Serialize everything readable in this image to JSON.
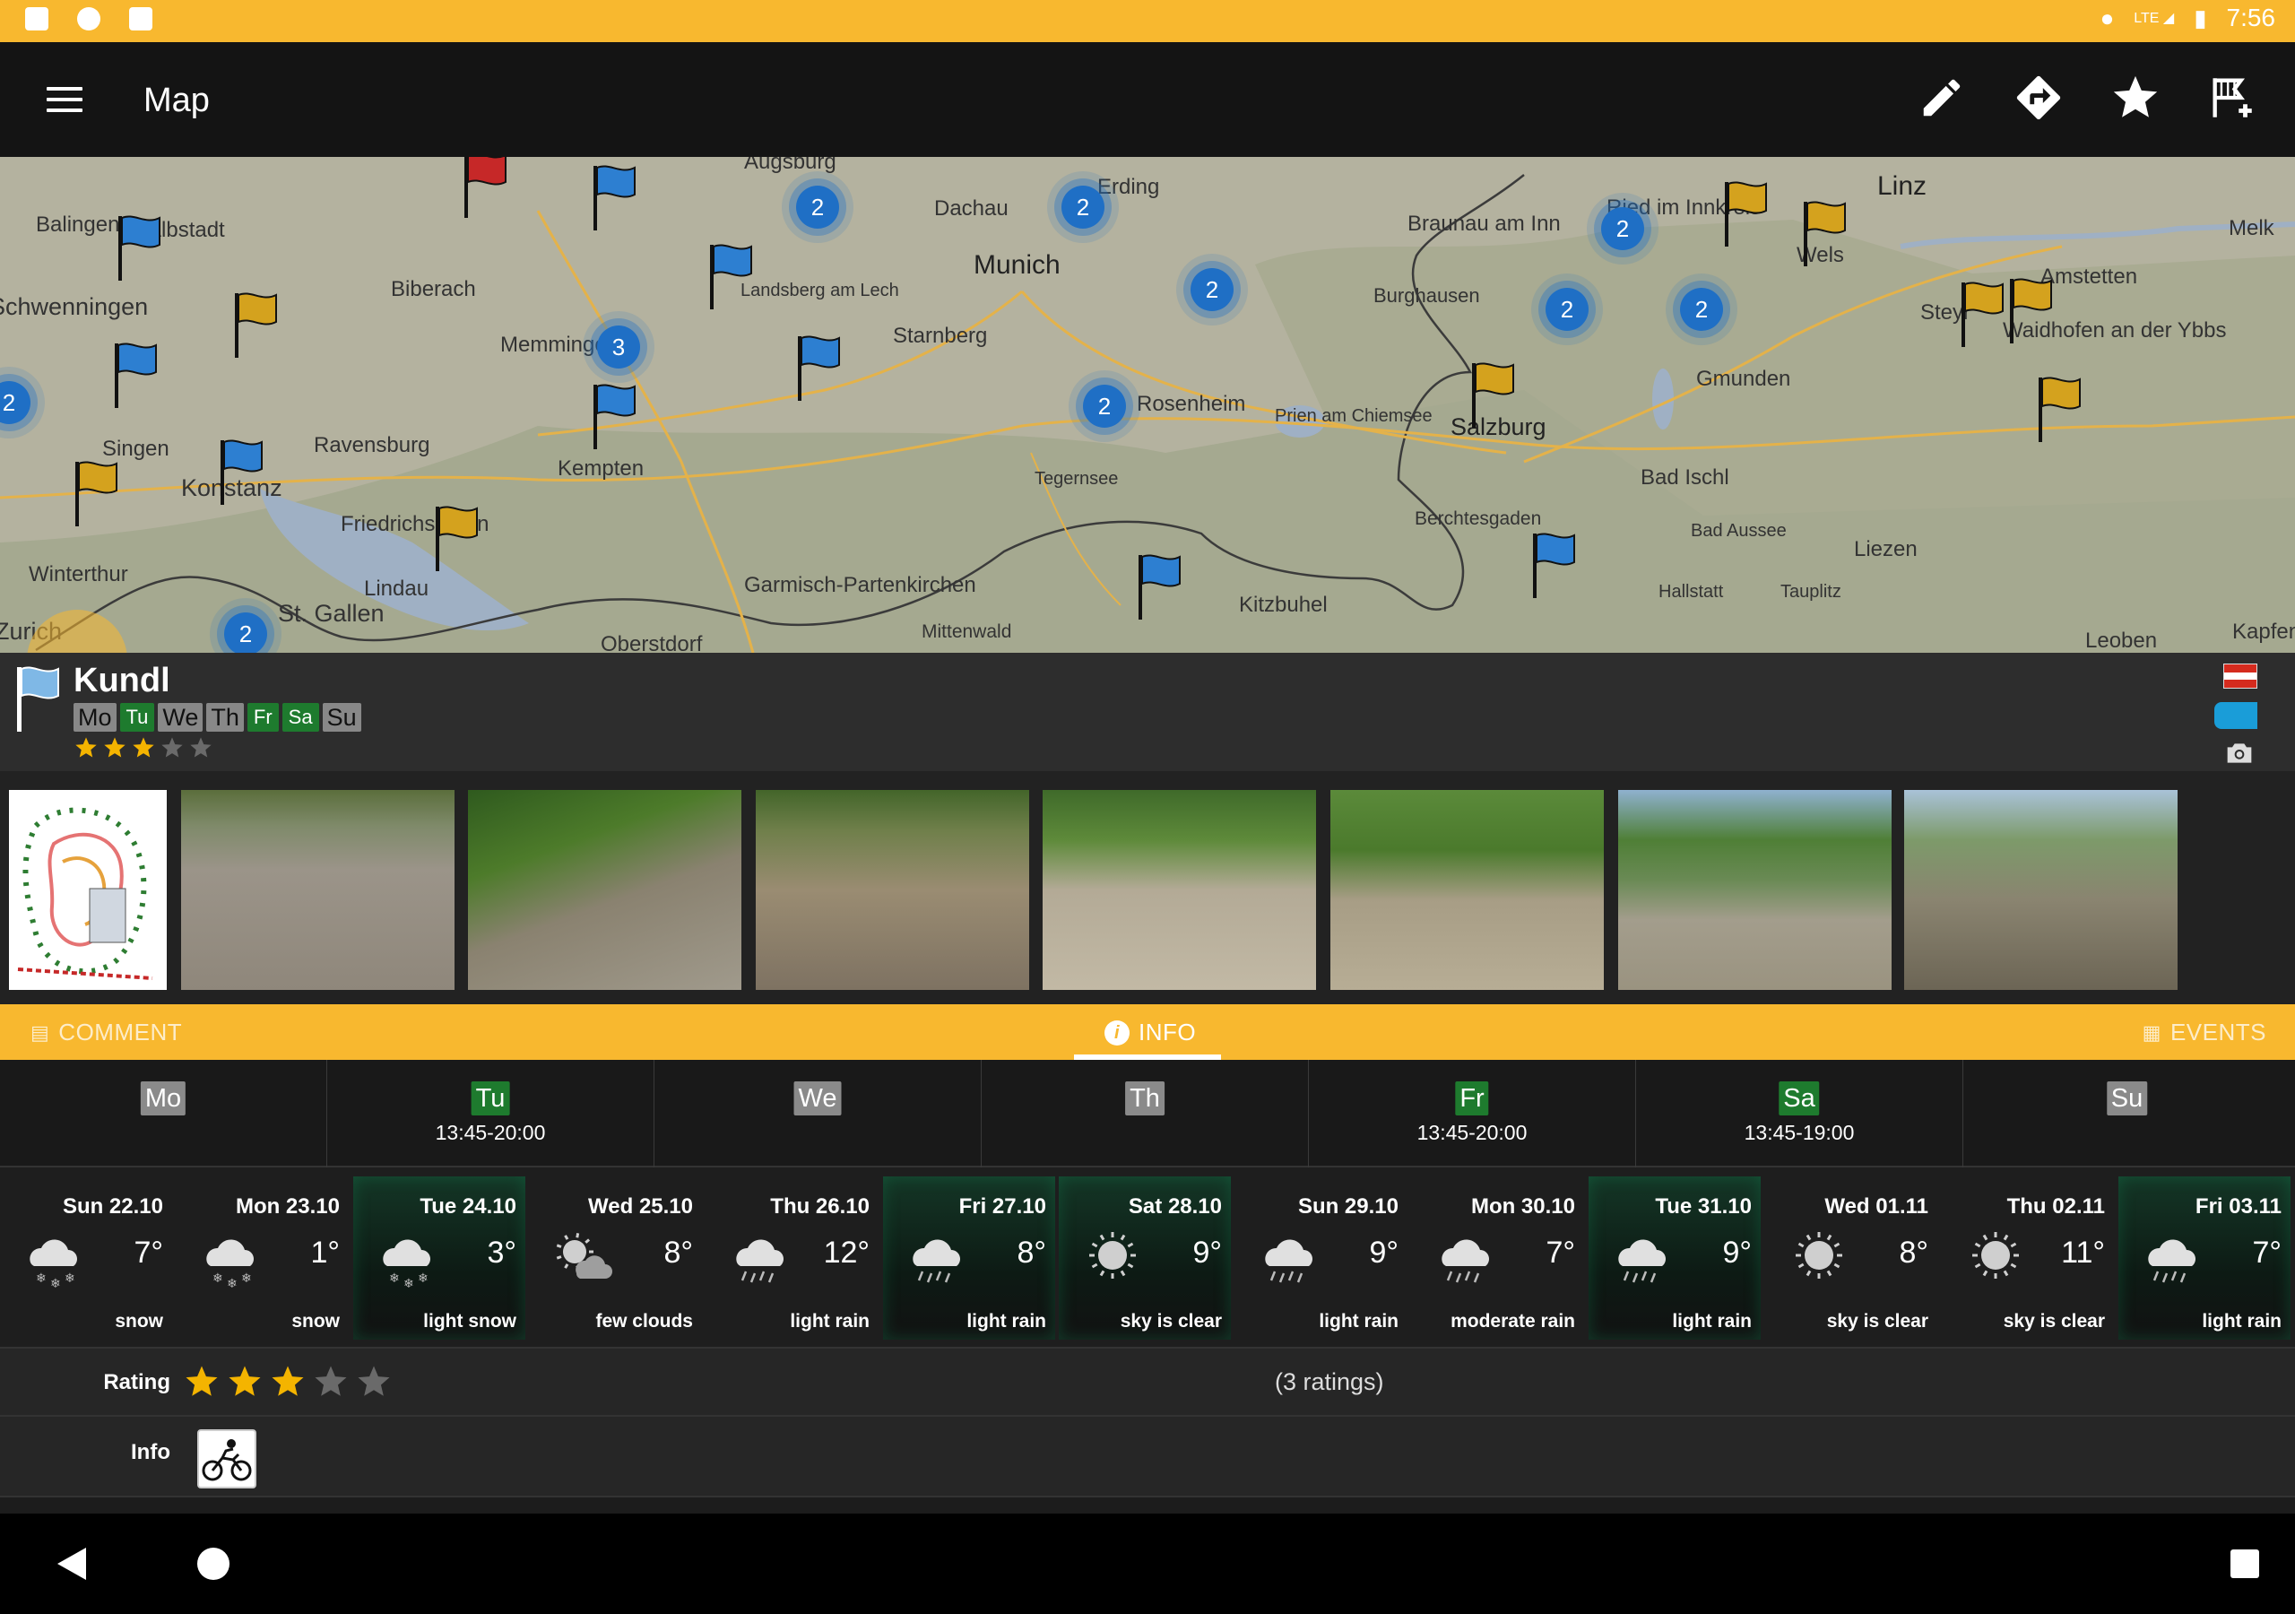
{
  "status_bar": {
    "time": "7:56",
    "network": "LTE"
  },
  "toolbar": {
    "title": "Map",
    "actions": [
      "edit-icon",
      "directions-icon",
      "favorite-star-icon",
      "add-track-icon"
    ]
  },
  "map": {
    "cities": [
      {
        "name": "Augsburg",
        "cls": ""
      },
      {
        "name": "Dachau",
        "cls": ""
      },
      {
        "name": "Erding",
        "cls": ""
      },
      {
        "name": "Munich",
        "cls": "big"
      },
      {
        "name": "Braunau am Inn",
        "cls": ""
      },
      {
        "name": "Ried im Innkreis",
        "cls": ""
      },
      {
        "name": "Linz",
        "cls": "big"
      },
      {
        "name": "Melk",
        "cls": ""
      },
      {
        "name": "Balingen",
        "cls": ""
      },
      {
        "name": "Albstadt",
        "cls": ""
      },
      {
        "name": "Biberach",
        "cls": ""
      },
      {
        "name": "Landsberg am Lech",
        "cls": "small"
      },
      {
        "name": "Wels",
        "cls": ""
      },
      {
        "name": "Amstetten",
        "cls": ""
      },
      {
        "name": "Schwenningen",
        "cls": ""
      },
      {
        "name": "Memmingen",
        "cls": ""
      },
      {
        "name": "Starnberg",
        "cls": ""
      },
      {
        "name": "Burghausen",
        "cls": ""
      },
      {
        "name": "Steyr",
        "cls": ""
      },
      {
        "name": "Waidhofen an der Ybbs",
        "cls": ""
      },
      {
        "name": "Gmunden",
        "cls": ""
      },
      {
        "name": "Rosenheim",
        "cls": ""
      },
      {
        "name": "Prien am Chiemsee",
        "cls": "small"
      },
      {
        "name": "Salzburg",
        "cls": "big"
      },
      {
        "name": "Singen",
        "cls": ""
      },
      {
        "name": "Ravensburg",
        "cls": ""
      },
      {
        "name": "Konstanz",
        "cls": ""
      },
      {
        "name": "Kempten",
        "cls": ""
      },
      {
        "name": "Tegernsee",
        "cls": "small"
      },
      {
        "name": "Bad Ischl",
        "cls": ""
      },
      {
        "name": "Friedrichshafen",
        "cls": ""
      },
      {
        "name": "Berchtesgaden",
        "cls": ""
      },
      {
        "name": "Bad Aussee",
        "cls": "small"
      },
      {
        "name": "Liezen",
        "cls": ""
      },
      {
        "name": "Winterthur",
        "cls": ""
      },
      {
        "name": "Lindau",
        "cls": ""
      },
      {
        "name": "Garmisch-Partenkirchen",
        "cls": ""
      },
      {
        "name": "Kitzbuhel",
        "cls": ""
      },
      {
        "name": "Hallstatt",
        "cls": "small"
      },
      {
        "name": "Tauplitz",
        "cls": "small"
      },
      {
        "name": "St. Gallen",
        "cls": ""
      },
      {
        "name": "Zurich",
        "cls": ""
      },
      {
        "name": "Oberstdorf",
        "cls": ""
      },
      {
        "name": "Mittenwald",
        "cls": ""
      },
      {
        "name": "Leoben",
        "cls": ""
      },
      {
        "name": "Kapfenberg",
        "cls": ""
      }
    ],
    "clusters": [
      "2",
      "2",
      "2",
      "2",
      "2",
      "2",
      "3",
      "2",
      "2",
      "2"
    ],
    "colors": {
      "map_bg": "#b4b29f",
      "water": "#9fb0c4",
      "road": "#e4b24a",
      "border": "#3b3b3b"
    }
  },
  "track": {
    "name": "Kundl",
    "days": [
      {
        "label": "Mo",
        "open": false
      },
      {
        "label": "Tu",
        "open": true
      },
      {
        "label": "We",
        "open": false
      },
      {
        "label": "Th",
        "open": false
      },
      {
        "label": "Fr",
        "open": true
      },
      {
        "label": "Sa",
        "open": true
      },
      {
        "label": "Su",
        "open": false
      }
    ],
    "rating": 3,
    "country": "Austria"
  },
  "tabs": {
    "comment": "COMMENT",
    "info": "INFO",
    "events": "EVENTS",
    "active": "INFO"
  },
  "hours": [
    {
      "day": "Mo",
      "open": false,
      "time": ""
    },
    {
      "day": "Tu",
      "open": true,
      "time": "13:45-20:00"
    },
    {
      "day": "We",
      "open": false,
      "time": ""
    },
    {
      "day": "Th",
      "open": false,
      "time": ""
    },
    {
      "day": "Fr",
      "open": true,
      "time": "13:45-20:00"
    },
    {
      "day": "Sa",
      "open": true,
      "time": "13:45-19:00"
    },
    {
      "day": "Su",
      "open": false,
      "time": ""
    }
  ],
  "weather": [
    {
      "date": "Sun 22.10",
      "temp": "7°",
      "desc": "snow",
      "icon": "snow-icon",
      "highlight": false
    },
    {
      "date": "Mon 23.10",
      "temp": "1°",
      "desc": "snow",
      "icon": "snow-icon",
      "highlight": false
    },
    {
      "date": "Tue 24.10",
      "temp": "3°",
      "desc": "light snow",
      "icon": "snow-icon",
      "highlight": true
    },
    {
      "date": "Wed 25.10",
      "temp": "8°",
      "desc": "few clouds",
      "icon": "few-clouds-icon",
      "highlight": false
    },
    {
      "date": "Thu 26.10",
      "temp": "12°",
      "desc": "light rain",
      "icon": "rain-icon",
      "highlight": false
    },
    {
      "date": "Fri 27.10",
      "temp": "8°",
      "desc": "light rain",
      "icon": "rain-icon",
      "highlight": true
    },
    {
      "date": "Sat 28.10",
      "temp": "9°",
      "desc": "sky is clear",
      "icon": "sun-icon",
      "highlight": true
    },
    {
      "date": "Sun 29.10",
      "temp": "9°",
      "desc": "light rain",
      "icon": "rain-icon",
      "highlight": false
    },
    {
      "date": "Mon 30.10",
      "temp": "7°",
      "desc": "moderate rain",
      "icon": "rain-icon",
      "highlight": false
    },
    {
      "date": "Tue 31.10",
      "temp": "9°",
      "desc": "light rain",
      "icon": "rain-icon",
      "highlight": true
    },
    {
      "date": "Wed 01.11",
      "temp": "8°",
      "desc": "sky is clear",
      "icon": "sun-icon",
      "highlight": false
    },
    {
      "date": "Thu 02.11",
      "temp": "11°",
      "desc": "sky is clear",
      "icon": "sun-icon",
      "highlight": false
    },
    {
      "date": "Fri 03.11",
      "temp": "7°",
      "desc": "light rain",
      "icon": "rain-icon",
      "highlight": true
    }
  ],
  "rating_row": {
    "label": "Rating",
    "stars": 3,
    "count_text": "(3 ratings)"
  },
  "info_row": {
    "label": "Info",
    "icon": "motocross-icon"
  },
  "colors": {
    "accent": "#f8b82f",
    "open_day": "#1e7b2e",
    "closed_day": "#8a8a8a",
    "star": "#f4b400"
  }
}
